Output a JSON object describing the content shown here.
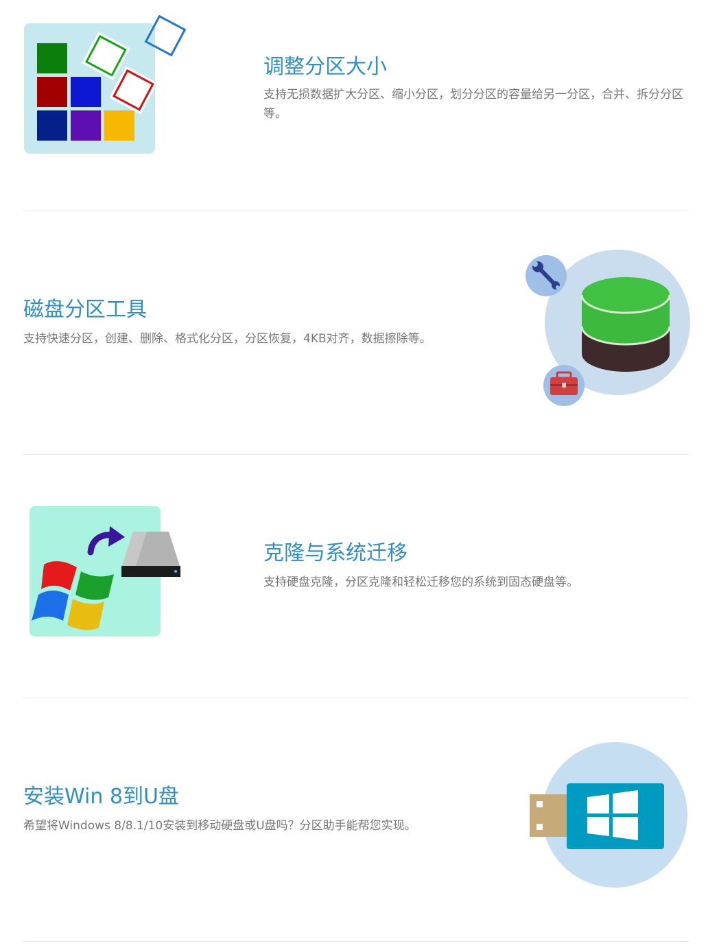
{
  "features": [
    {
      "title": "调整分区大小",
      "description": "支持无损数据扩大分区、缩小分区，划分分区的容量给另一分区，合并、拆分分区等。",
      "icon": "resize-partition-icon"
    },
    {
      "title": "磁盘分区工具",
      "description": "支持快速分区，创建、删除、格式化分区，分区恢复，4KB对齐，数据擦除等。",
      "icon": "disk-partition-tool-icon"
    },
    {
      "title": "克隆与系统迁移",
      "description": "支持硬盘克隆，分区克隆和轻松迁移您的系统到固态硬盘等。",
      "icon": "clone-migrate-icon"
    },
    {
      "title": "安装Win 8到U盘",
      "description": "希望将Windows 8/8.1/10安装到移动硬盘或U盘吗？分区助手能帮您实现。",
      "icon": "windows-usb-icon"
    }
  ],
  "colors": {
    "title": "#2f8fc4",
    "description": "#777777",
    "divider": "#e6e6e6"
  }
}
